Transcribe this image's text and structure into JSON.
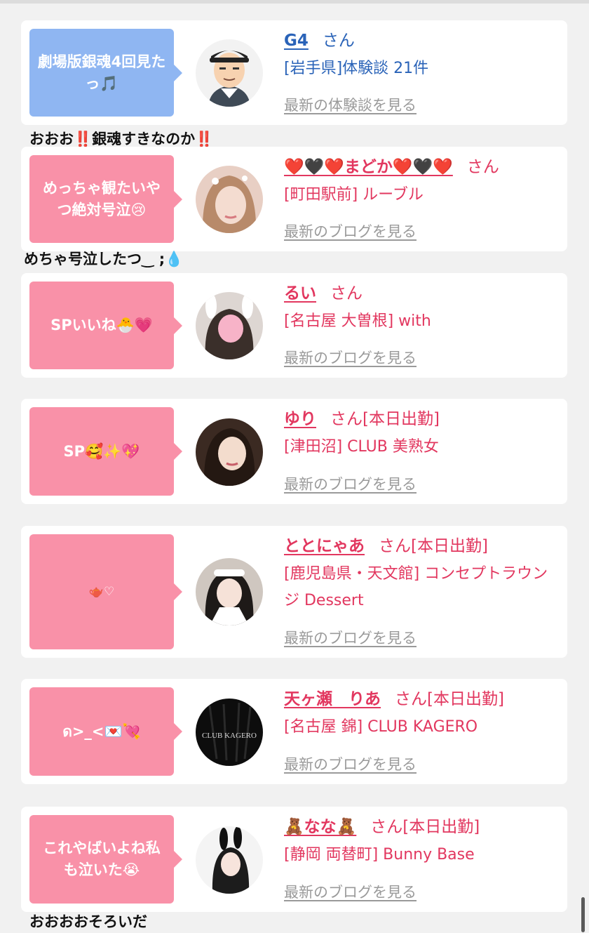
{
  "colors": {
    "accent_pink": "#e2375f",
    "accent_blue": "#2a63b8",
    "bubble_blue": "#8fb6f2",
    "bubble_pink": "#f991a8",
    "link_gray": "#9a9a9a"
  },
  "entries": [
    {
      "bubble": "劇場版銀魂4回見たっ🎵",
      "name": "G4",
      "suffix": "さん",
      "place": "[岩手県]体験談 21件",
      "link": "最新の体験談を見る",
      "comment": "おおお‼️銀魂すきなのか‼️"
    },
    {
      "bubble": "めっちゃ観たいやつ絶対号泣😢",
      "name": "❤️🖤❤️まどか❤️🖤❤️",
      "suffix": "さん",
      "place": "[町田駅前] ルーブル",
      "link": "最新のブログを見る",
      "comment": "めちゃ号泣したつ‿ ;💧"
    },
    {
      "bubble": "SPいいね🐣💗",
      "name": "るい",
      "suffix": "さん",
      "place": "[名古屋 大曽根] with",
      "link": "最新のブログを見る"
    },
    {
      "bubble": "SP🥰✨💖",
      "name": "ゆり",
      "suffix": "さん[本日出勤]",
      "place": "[津田沼] CLUB 美熟女",
      "link": "最新のブログを見る"
    },
    {
      "bubble": "🫖♡",
      "name": "ととにゃあ",
      "suffix": "さん[本日出勤]",
      "place": "[鹿児島県・天文館] コンセプトラウンジ Dessert",
      "link": "最新のブログを見る"
    },
    {
      "bubble": "ด>_<💌💘",
      "name": "天ヶ瀬　りあ",
      "suffix": "さん[本日出勤]",
      "place": "[名古屋 錦] CLUB KAGERO",
      "link": "最新のブログを見る",
      "avatar_text": "CLUB KAGERO"
    },
    {
      "bubble": "これやばいよね私も泣いた😭",
      "name": "🧸なな🧸",
      "suffix": "さん[本日出勤]",
      "place": "[静岡 両替町] Bunny Base",
      "link": "最新のブログを見る",
      "comment": "おおおおそろいだ"
    }
  ]
}
